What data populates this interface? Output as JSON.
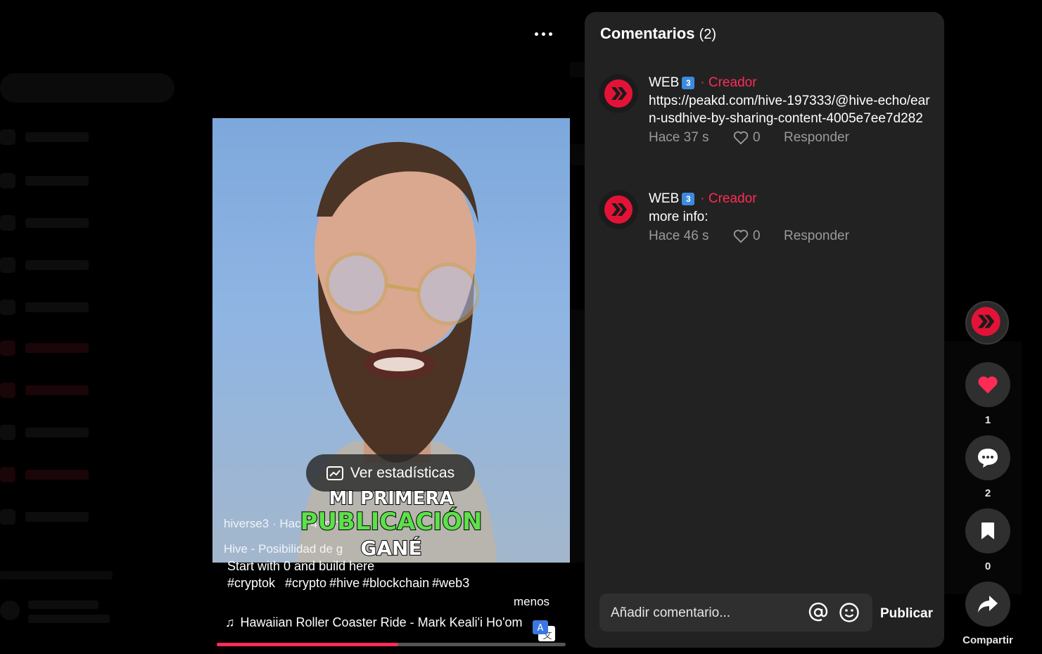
{
  "comments_panel": {
    "title": "Comentarios",
    "count": "(2)",
    "items": [
      {
        "author": "WEB",
        "badge": "3",
        "creator_tag": "· Creador",
        "text": "https://peakd.com/hive-197333/@hive-echo/earn-usdhive-by-sharing-content-4005e7ee7d282",
        "time": "Hace 37 s",
        "likes": "0",
        "reply": "Responder"
      },
      {
        "author": "WEB",
        "badge": "3",
        "creator_tag": "· Creador",
        "text": "more info:",
        "time": "Hace 46 s",
        "likes": "0",
        "reply": "Responder"
      }
    ],
    "input_placeholder": "Añadir comentario...",
    "post_label": "Publicar"
  },
  "video": {
    "stats_label": "Ver estadísticas",
    "caption_lines": [
      "MI PRIMERA",
      "PUBLICACIÓN",
      "GANÉ"
    ],
    "author_line": "hiverse3 · Hace 4 min",
    "description_line1": "Hive - Posibilidad de g",
    "description_line2": "Start with 0 and build here",
    "hashtags": [
      "#cryptok",
      "#crypto",
      "#hive",
      "#blockchain",
      "#web3"
    ],
    "less_label": "menos",
    "music": "Hawaiian Roller Coaster Ride - Mark Keali'i Ho'om",
    "progress": 0.52
  },
  "actions": {
    "likes": "1",
    "comments": "2",
    "saves": "0",
    "share_label": "Compartir"
  },
  "colors": {
    "accent": "#fe2c55",
    "panel": "#222222",
    "hive": "#e31337"
  }
}
